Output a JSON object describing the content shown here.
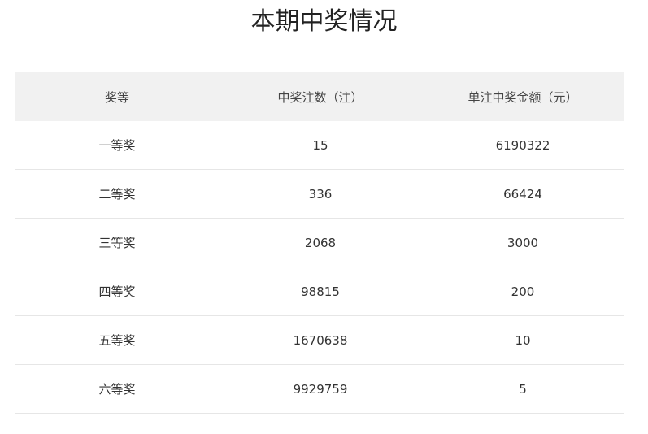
{
  "page": {
    "title": "本期中奖情况"
  },
  "table": {
    "headers": [
      "奖等",
      "中奖注数（注）",
      "单注中奖金额（元）"
    ],
    "rows": [
      [
        "一等奖",
        "15",
        "6190322"
      ],
      [
        "二等奖",
        "336",
        "66424"
      ],
      [
        "三等奖",
        "2068",
        "3000"
      ],
      [
        "四等奖",
        "98815",
        "200"
      ],
      [
        "五等奖",
        "1670638",
        "10"
      ],
      [
        "六等奖",
        "9929759",
        "5"
      ]
    ]
  }
}
